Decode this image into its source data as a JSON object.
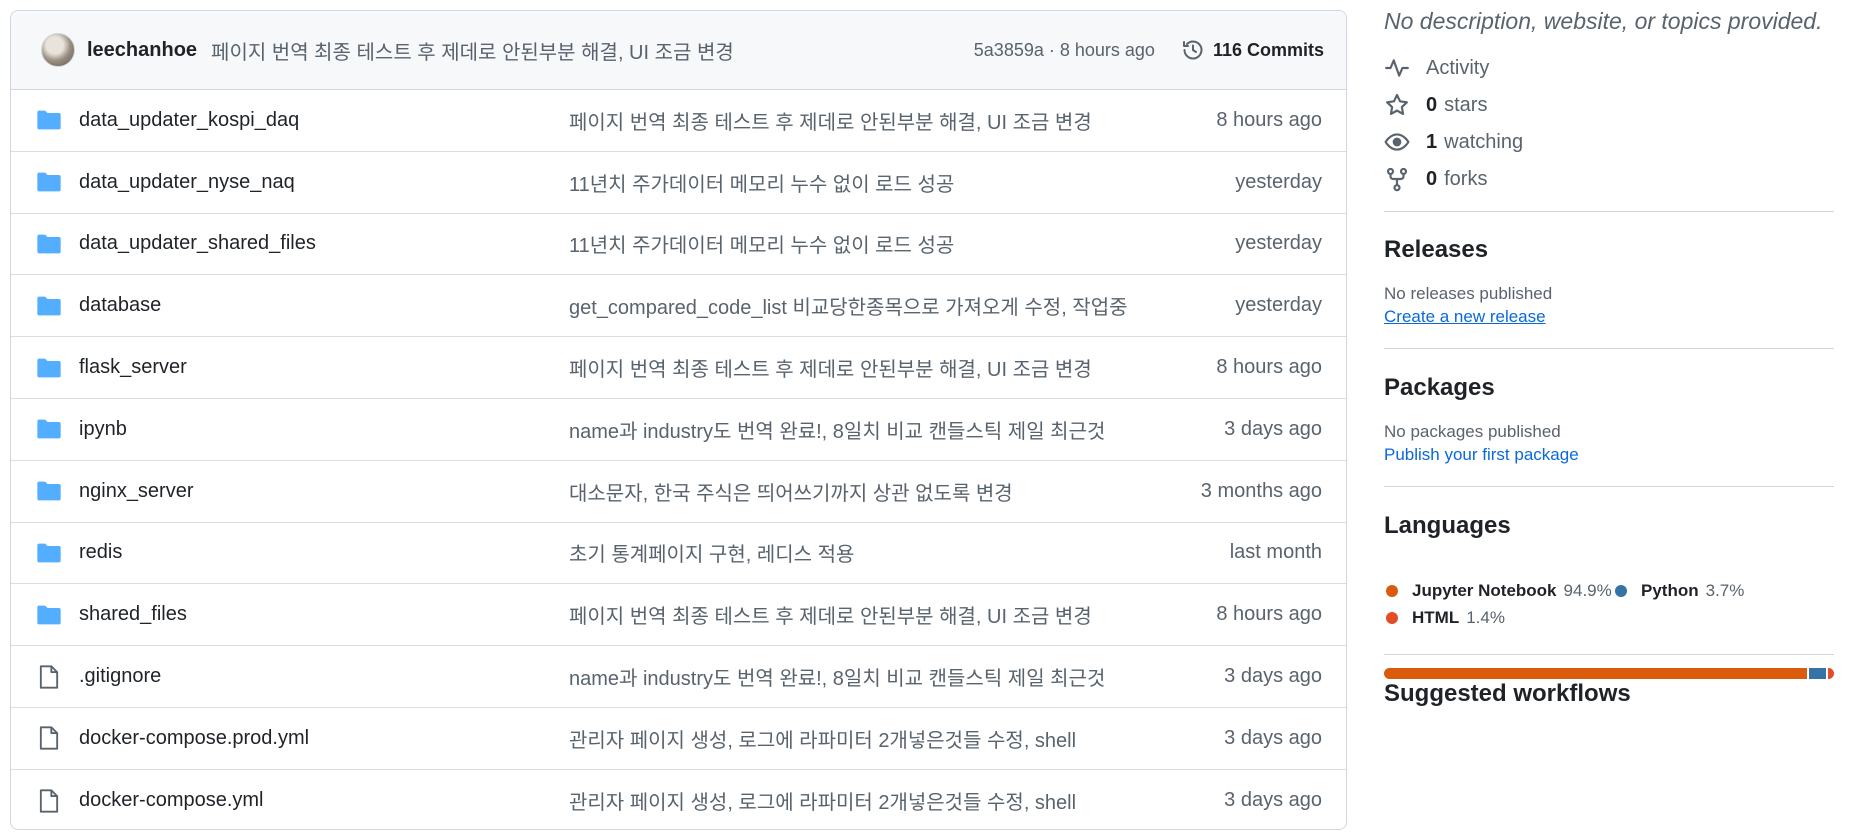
{
  "commit": {
    "author": "leechanhoe",
    "message": "페이지 번역 최종 테스트 후 제데로 안된부분 해결, UI 조금 변경",
    "meta": "5a3859a · 8 hours ago",
    "commits_label": "116 Commits"
  },
  "files": [
    {
      "name": "data_updater_kospi_daq",
      "type": "folder",
      "message": "페이지 번역 최종 테스트 후 제데로 안된부분 해결, UI 조금 변경",
      "date": "8 hours ago"
    },
    {
      "name": "data_updater_nyse_naq",
      "type": "folder",
      "message": "11년치 주가데이터 메모리 누수 없이 로드 성공",
      "date": "yesterday"
    },
    {
      "name": "data_updater_shared_files",
      "type": "folder",
      "message": "11년치 주가데이터 메모리 누수 없이 로드 성공",
      "date": "yesterday"
    },
    {
      "name": "database",
      "type": "folder",
      "message": "get_compared_code_list 비교당한종목으로 가져오게 수정, 작업중",
      "date": "yesterday"
    },
    {
      "name": "flask_server",
      "type": "folder",
      "message": "페이지 번역 최종 테스트 후 제데로 안된부분 해결, UI 조금 변경",
      "date": "8 hours ago"
    },
    {
      "name": "ipynb",
      "type": "folder",
      "message": "name과 industry도 번역 완료!, 8일치 비교 캔들스틱 제일 최근것",
      "date": "3 days ago"
    },
    {
      "name": "nginx_server",
      "type": "folder",
      "message": "대소문자, 한국 주식은 띄어쓰기까지 상관 없도록 변경",
      "date": "3 months ago"
    },
    {
      "name": "redis",
      "type": "folder",
      "message": "초기 통계페이지 구현, 레디스 적용",
      "date": "last month"
    },
    {
      "name": "shared_files",
      "type": "folder",
      "message": "페이지 번역 최종 테스트 후 제데로 안된부분 해결, UI 조금 변경",
      "date": "8 hours ago"
    },
    {
      "name": ".gitignore",
      "type": "file",
      "message": "name과 industry도 번역 완료!, 8일치 비교 캔들스틱 제일 최근것",
      "date": "3 days ago"
    },
    {
      "name": "docker-compose.prod.yml",
      "type": "file",
      "message": "관리자 페이지 생성, 로그에 라파미터 2개넣은것들 수정, shell",
      "date": "3 days ago"
    },
    {
      "name": "docker-compose.yml",
      "type": "file",
      "message": "관리자 페이지 생성, 로그에 라파미터 2개넣은것들 수정, shell",
      "date": "3 days ago"
    }
  ],
  "sidebar": {
    "description": "No description, website, or topics provided.",
    "activity": "Activity",
    "stars_count": "0",
    "stars_label": "stars",
    "watching_count": "1",
    "watching_label": "watching",
    "forks_count": "0",
    "forks_label": "forks",
    "releases_title": "Releases",
    "releases_note": "No releases published",
    "releases_link": "Create a new release",
    "packages_title": "Packages",
    "packages_note": "No packages published",
    "packages_link": "Publish your first package",
    "languages_title": "Languages",
    "languages": [
      {
        "name": "Jupyter Notebook",
        "percent": "94.9%",
        "value": 94.9,
        "color": "#DA5B0B"
      },
      {
        "name": "Python",
        "percent": "3.7%",
        "value": 3.7,
        "color": "#3572A5"
      },
      {
        "name": "HTML",
        "percent": "1.4%",
        "value": 1.4,
        "color": "#e34c26"
      }
    ],
    "workflows_title": "Suggested workflows"
  }
}
